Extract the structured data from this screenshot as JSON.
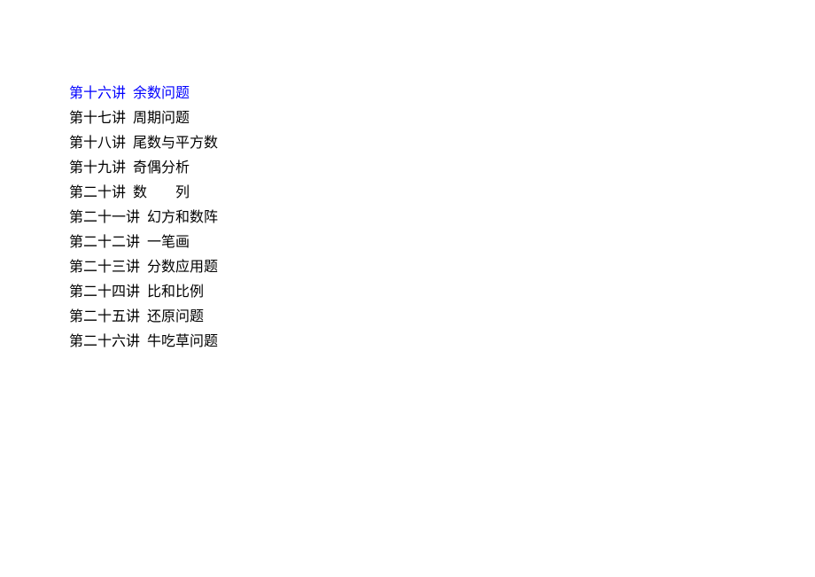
{
  "toc": {
    "items": [
      {
        "label": "第十六讲  余数问题",
        "highlighted": true
      },
      {
        "label": "第十七讲  周期问题",
        "highlighted": false
      },
      {
        "label": "第十八讲  尾数与平方数",
        "highlighted": false
      },
      {
        "label": "第十九讲  奇偶分析",
        "highlighted": false
      },
      {
        "label": "第二十讲  数        列",
        "highlighted": false
      },
      {
        "label": "第二十一讲  幻方和数阵",
        "highlighted": false
      },
      {
        "label": "第二十二讲  一笔画",
        "highlighted": false
      },
      {
        "label": "第二十三讲  分数应用题",
        "highlighted": false
      },
      {
        "label": "第二十四讲  比和比例",
        "highlighted": false
      },
      {
        "label": "第二十五讲  还原问题",
        "highlighted": false
      },
      {
        "label": "第二十六讲  牛吃草问题",
        "highlighted": false
      }
    ]
  }
}
